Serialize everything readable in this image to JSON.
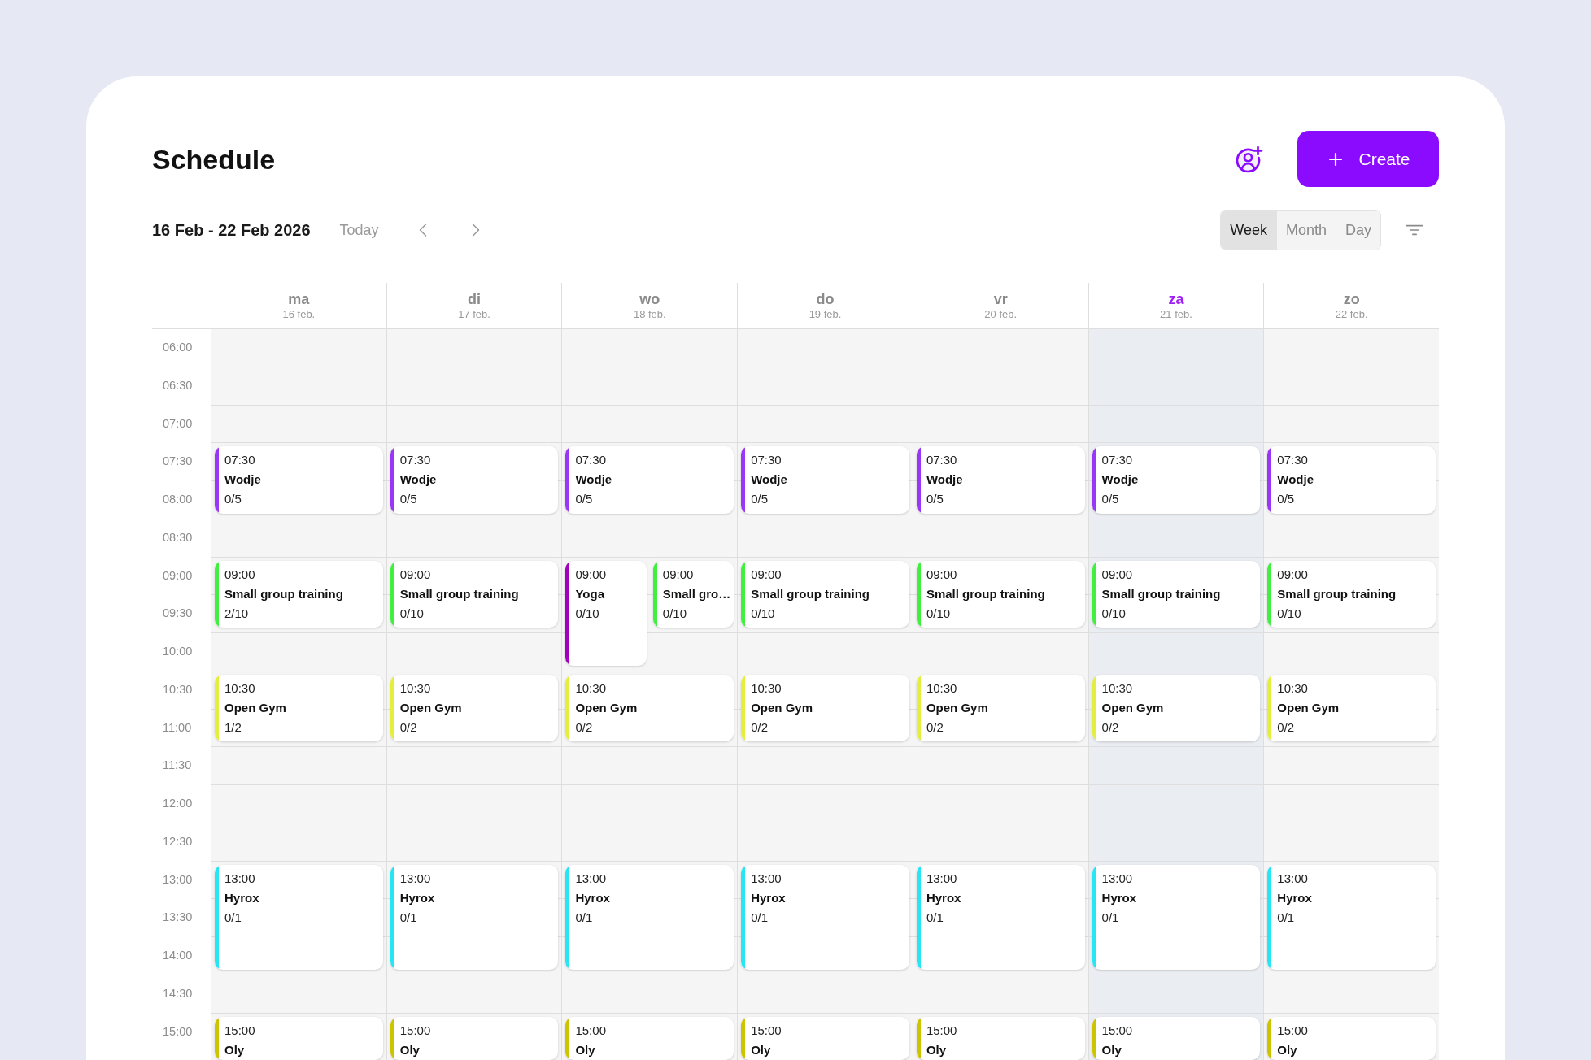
{
  "header": {
    "title": "Schedule",
    "create_button": "Create"
  },
  "toolbar": {
    "date_range": "16 Feb - 22 Feb 2026",
    "today_button": "Today",
    "views": [
      {
        "label": "Week",
        "selected": true
      },
      {
        "label": "Month",
        "selected": false
      },
      {
        "label": "Day",
        "selected": false
      }
    ]
  },
  "calendar": {
    "time_slots": [
      "06:00",
      "06:30",
      "07:00",
      "07:30",
      "08:00",
      "08:30",
      "09:00",
      "09:30",
      "10:00",
      "10:30",
      "11:00",
      "11:30",
      "12:00",
      "12:30",
      "13:00",
      "13:30",
      "14:00",
      "14:30",
      "15:00"
    ],
    "days": [
      {
        "name": "ma",
        "date": "16 feb.",
        "today": false,
        "events": [
          {
            "kind": "short",
            "time": "07:30",
            "title": "Wodje",
            "capacity": "0/5",
            "color": "#9a36f6"
          },
          {
            "kind": "short",
            "time": "09:00",
            "title": "Small group training",
            "capacity": "2/10",
            "color": "#40ef40"
          },
          {
            "kind": "short",
            "time": "10:30",
            "title": "Open Gym",
            "capacity": "1/2",
            "color": "#e3ef3c"
          },
          {
            "kind": "tall",
            "time": "13:00",
            "title": "Hyrox",
            "capacity": "0/1",
            "color": "#25e6f2"
          },
          {
            "kind": "cut",
            "time": "15:00",
            "title": "Oly",
            "color": "#cdc400"
          }
        ]
      },
      {
        "name": "di",
        "date": "17 feb.",
        "today": false,
        "events": [
          {
            "kind": "short",
            "time": "07:30",
            "title": "Wodje",
            "capacity": "0/5",
            "color": "#9a36f6"
          },
          {
            "kind": "short",
            "time": "09:00",
            "title": "Small group training",
            "capacity": "0/10",
            "color": "#40ef40"
          },
          {
            "kind": "short",
            "time": "10:30",
            "title": "Open Gym",
            "capacity": "0/2",
            "color": "#e3ef3c"
          },
          {
            "kind": "tall",
            "time": "13:00",
            "title": "Hyrox",
            "capacity": "0/1",
            "color": "#25e6f2"
          },
          {
            "kind": "cut",
            "time": "15:00",
            "title": "Oly",
            "color": "#cdc400"
          }
        ]
      },
      {
        "name": "wo",
        "date": "18 feb.",
        "today": false,
        "events": [
          {
            "kind": "short",
            "time": "07:30",
            "title": "Wodje",
            "capacity": "0/5",
            "color": "#9a36f6"
          },
          {
            "kind": "tall",
            "time": "09:00",
            "title": "Yoga",
            "capacity": "0/10",
            "color": "#a300bd"
          },
          {
            "kind": "short",
            "time": "09:00",
            "title": "Small gro…",
            "capacity": "0/10",
            "color": "#40ef40"
          },
          {
            "kind": "short",
            "time": "10:30",
            "title": "Open Gym",
            "capacity": "0/2",
            "color": "#e3ef3c"
          },
          {
            "kind": "tall",
            "time": "13:00",
            "title": "Hyrox",
            "capacity": "0/1",
            "color": "#25e6f2"
          },
          {
            "kind": "cut",
            "time": "15:00",
            "title": "Oly",
            "color": "#cdc400"
          }
        ]
      },
      {
        "name": "do",
        "date": "19 feb.",
        "today": false,
        "events": [
          {
            "kind": "short",
            "time": "07:30",
            "title": "Wodje",
            "capacity": "0/5",
            "color": "#9a36f6"
          },
          {
            "kind": "short",
            "time": "09:00",
            "title": "Small group training",
            "capacity": "0/10",
            "color": "#40ef40"
          },
          {
            "kind": "short",
            "time": "10:30",
            "title": "Open Gym",
            "capacity": "0/2",
            "color": "#e3ef3c"
          },
          {
            "kind": "tall",
            "time": "13:00",
            "title": "Hyrox",
            "capacity": "0/1",
            "color": "#25e6f2"
          },
          {
            "kind": "cut",
            "time": "15:00",
            "title": "Oly",
            "color": "#cdc400"
          }
        ]
      },
      {
        "name": "vr",
        "date": "20 feb.",
        "today": false,
        "events": [
          {
            "kind": "short",
            "time": "07:30",
            "title": "Wodje",
            "capacity": "0/5",
            "color": "#9a36f6"
          },
          {
            "kind": "short",
            "time": "09:00",
            "title": "Small group training",
            "capacity": "0/10",
            "color": "#40ef40"
          },
          {
            "kind": "short",
            "time": "10:30",
            "title": "Open Gym",
            "capacity": "0/2",
            "color": "#e3ef3c"
          },
          {
            "kind": "tall",
            "time": "13:00",
            "title": "Hyrox",
            "capacity": "0/1",
            "color": "#25e6f2"
          },
          {
            "kind": "cut",
            "time": "15:00",
            "title": "Oly",
            "color": "#cdc400"
          }
        ]
      },
      {
        "name": "za",
        "date": "21 feb.",
        "today": true,
        "events": [
          {
            "kind": "short",
            "time": "07:30",
            "title": "Wodje",
            "capacity": "0/5",
            "color": "#9a36f6"
          },
          {
            "kind": "short",
            "time": "09:00",
            "title": "Small group training",
            "capacity": "0/10",
            "color": "#40ef40"
          },
          {
            "kind": "short",
            "time": "10:30",
            "title": "Open Gym",
            "capacity": "0/2",
            "color": "#e3ef3c"
          },
          {
            "kind": "tall",
            "time": "13:00",
            "title": "Hyrox",
            "capacity": "0/1",
            "color": "#25e6f2"
          },
          {
            "kind": "cut",
            "time": "15:00",
            "title": "Oly",
            "color": "#cdc400"
          }
        ]
      },
      {
        "name": "zo",
        "date": "22 feb.",
        "today": false,
        "events": [
          {
            "kind": "short",
            "time": "07:30",
            "title": "Wodje",
            "capacity": "0/5",
            "color": "#9a36f6"
          },
          {
            "kind": "short",
            "time": "09:00",
            "title": "Small group training",
            "capacity": "0/10",
            "color": "#40ef40"
          },
          {
            "kind": "short",
            "time": "10:30",
            "title": "Open Gym",
            "capacity": "0/2",
            "color": "#e3ef3c"
          },
          {
            "kind": "tall",
            "time": "13:00",
            "title": "Hyrox",
            "capacity": "0/1",
            "color": "#25e6f2"
          },
          {
            "kind": "cut",
            "time": "15:00",
            "title": "Oly",
            "color": "#cdc400"
          }
        ]
      }
    ]
  }
}
